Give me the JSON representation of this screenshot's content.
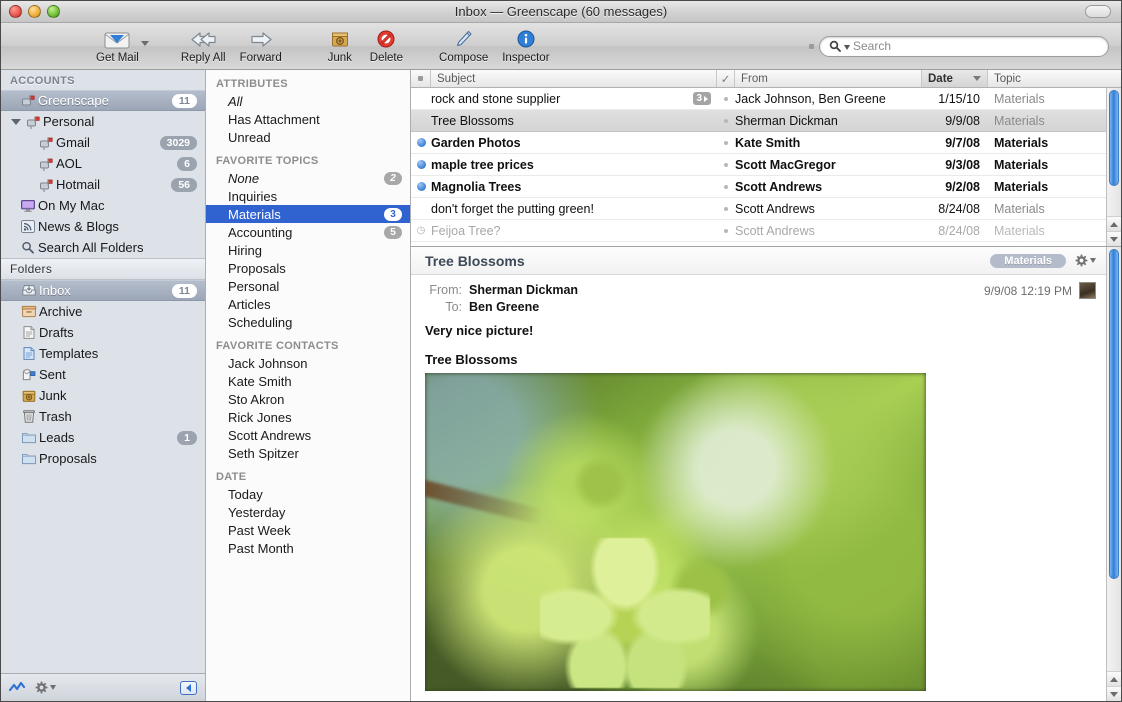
{
  "window": {
    "title": "Inbox — Greenscape (60 messages)",
    "traffic_lights": [
      "close",
      "minimize",
      "zoom"
    ],
    "toolbar_toggle": "toolbar-toggle-pill"
  },
  "toolbar": {
    "items": [
      {
        "label": "Get Mail",
        "icon": "envelope-icon",
        "has_menu": true
      },
      {
        "label": "Reply All",
        "icon": "reply-all-arrow-icon",
        "has_menu": false
      },
      {
        "label": "Forward",
        "icon": "forward-arrow-icon",
        "has_menu": false
      },
      {
        "label": "Junk",
        "icon": "junk-bin-icon",
        "has_menu": false
      },
      {
        "label": "Delete",
        "icon": "delete-prohibit-icon",
        "has_menu": false
      },
      {
        "label": "Compose",
        "icon": "pen-compose-icon",
        "has_menu": false
      },
      {
        "label": "Inspector",
        "icon": "info-circle-icon",
        "has_menu": false
      }
    ],
    "search": {
      "placeholder": "Search",
      "icon": "magnifier-icon"
    }
  },
  "sidebar": {
    "accounts_header": "ACCOUNTS",
    "accounts": [
      {
        "label": "Greenscape",
        "icon": "mailbox-icon",
        "badge": "11",
        "selected": true,
        "indent": 1,
        "disclosure": false
      },
      {
        "label": "Personal",
        "icon": "mailbox-icon",
        "badge": "",
        "selected": false,
        "indent": 1,
        "disclosure": true
      },
      {
        "label": "Gmail",
        "icon": "mailbox-icon",
        "badge": "3029",
        "selected": false,
        "indent": 2,
        "disclosure": false
      },
      {
        "label": "AOL",
        "icon": "mailbox-icon",
        "badge": "6",
        "selected": false,
        "indent": 2,
        "disclosure": false
      },
      {
        "label": "Hotmail",
        "icon": "mailbox-icon",
        "badge": "56",
        "selected": false,
        "indent": 2,
        "disclosure": false
      },
      {
        "label": "On My Mac",
        "icon": "display-icon",
        "badge": "",
        "selected": false,
        "indent": 1,
        "disclosure": false
      },
      {
        "label": "News & Blogs",
        "icon": "rss-icon",
        "badge": "",
        "selected": false,
        "indent": 1,
        "disclosure": false
      },
      {
        "label": "Search All Folders",
        "icon": "magnifier-icon",
        "badge": "",
        "selected": false,
        "indent": 1,
        "disclosure": false
      }
    ],
    "folders_header": "Folders",
    "folders": [
      {
        "label": "Inbox",
        "icon": "inbox-tray-icon",
        "badge": "11",
        "selected": true
      },
      {
        "label": "Archive",
        "icon": "archive-box-icon",
        "badge": "",
        "selected": false
      },
      {
        "label": "Drafts",
        "icon": "draft-page-icon",
        "badge": "",
        "selected": false
      },
      {
        "label": "Templates",
        "icon": "template-page-icon",
        "badge": "",
        "selected": false
      },
      {
        "label": "Sent",
        "icon": "sent-envelope-icon",
        "badge": "",
        "selected": false
      },
      {
        "label": "Junk",
        "icon": "junk-bin-icon",
        "badge": "",
        "selected": false
      },
      {
        "label": "Trash",
        "icon": "trash-can-icon",
        "badge": "",
        "selected": false
      },
      {
        "label": "Leads",
        "icon": "folder-icon",
        "badge": "1",
        "selected": false
      },
      {
        "label": "Proposals",
        "icon": "folder-icon",
        "badge": "",
        "selected": false
      }
    ],
    "footer": {
      "activity_icon": "activity-zigzag-icon",
      "gear_icon": "gear-icon",
      "collapse_icon": "collapse-left-icon"
    }
  },
  "filters": {
    "sections": [
      {
        "header": "ATTRIBUTES",
        "items": [
          {
            "label": "All",
            "italic": true,
            "badge": "",
            "selected": false
          },
          {
            "label": "Has Attachment",
            "italic": false,
            "badge": "",
            "selected": false
          },
          {
            "label": "Unread",
            "italic": false,
            "badge": "",
            "selected": false
          }
        ]
      },
      {
        "header": "FAVORITE TOPICS",
        "items": [
          {
            "label": "None",
            "italic": true,
            "badge": "2",
            "selected": false
          },
          {
            "label": "Inquiries",
            "italic": false,
            "badge": "",
            "selected": false
          },
          {
            "label": "Materials",
            "italic": false,
            "badge": "3",
            "selected": true
          },
          {
            "label": "Accounting",
            "italic": false,
            "badge": "5",
            "selected": false
          },
          {
            "label": "Hiring",
            "italic": false,
            "badge": "",
            "selected": false
          },
          {
            "label": "Proposals",
            "italic": false,
            "badge": "",
            "selected": false
          },
          {
            "label": "Personal",
            "italic": false,
            "badge": "",
            "selected": false
          },
          {
            "label": "Articles",
            "italic": false,
            "badge": "",
            "selected": false
          },
          {
            "label": "Scheduling",
            "italic": false,
            "badge": "",
            "selected": false
          }
        ]
      },
      {
        "header": "FAVORITE CONTACTS",
        "items": [
          {
            "label": "Jack Johnson",
            "italic": false,
            "badge": "",
            "selected": false
          },
          {
            "label": "Kate Smith",
            "italic": false,
            "badge": "",
            "selected": false
          },
          {
            "label": "Sto Akron",
            "italic": false,
            "badge": "",
            "selected": false
          },
          {
            "label": "Rick Jones",
            "italic": false,
            "badge": "",
            "selected": false
          },
          {
            "label": "Scott Andrews",
            "italic": false,
            "badge": "",
            "selected": false
          },
          {
            "label": "Seth Spitzer",
            "italic": false,
            "badge": "",
            "selected": false
          }
        ]
      },
      {
        "header": "DATE",
        "items": [
          {
            "label": "Today",
            "italic": false,
            "badge": "",
            "selected": false
          },
          {
            "label": "Yesterday",
            "italic": false,
            "badge": "",
            "selected": false
          },
          {
            "label": "Past Week",
            "italic": false,
            "badge": "",
            "selected": false
          },
          {
            "label": "Past Month",
            "italic": false,
            "badge": "",
            "selected": false
          }
        ]
      }
    ]
  },
  "message_list": {
    "columns": [
      {
        "label": "",
        "key": "flag",
        "active": false
      },
      {
        "label": "Subject",
        "key": "subject",
        "active": false
      },
      {
        "label": "✓",
        "key": "check",
        "active": false
      },
      {
        "label": "From",
        "key": "from",
        "active": false
      },
      {
        "label": "Date",
        "key": "date",
        "active": true,
        "sort": "descending"
      },
      {
        "label": "Topic",
        "key": "topic",
        "active": false
      }
    ],
    "rows": [
      {
        "subject": "rock and stone supplier",
        "from": "Jack Johnson, Ben Greene",
        "date": "1/15/10",
        "topic": "Materials",
        "unread": false,
        "selected": false,
        "muted": false,
        "thread_count": "3"
      },
      {
        "subject": "Tree Blossoms",
        "from": "Sherman Dickman",
        "date": "9/9/08",
        "topic": "Materials",
        "unread": false,
        "selected": true,
        "muted": false,
        "thread_count": ""
      },
      {
        "subject": "Garden Photos",
        "from": "Kate Smith",
        "date": "9/7/08",
        "topic": "Materials",
        "unread": true,
        "selected": false,
        "muted": false,
        "thread_count": ""
      },
      {
        "subject": "maple tree prices",
        "from": "Scott MacGregor",
        "date": "9/3/08",
        "topic": "Materials",
        "unread": true,
        "selected": false,
        "muted": false,
        "thread_count": ""
      },
      {
        "subject": "Magnolia Trees",
        "from": "Scott Andrews",
        "date": "9/2/08",
        "topic": "Materials",
        "unread": true,
        "selected": false,
        "muted": false,
        "thread_count": ""
      },
      {
        "subject": "don't forget the putting green!",
        "from": "Scott Andrews",
        "date": "8/24/08",
        "topic": "Materials",
        "unread": false,
        "selected": false,
        "muted": false,
        "thread_count": ""
      },
      {
        "subject": "Feijoa Tree?",
        "from": "Scott Andrews",
        "date": "8/24/08",
        "topic": "Materials",
        "unread": false,
        "selected": false,
        "muted": true,
        "thread_count": ""
      }
    ]
  },
  "message_view": {
    "subject": "Tree Blossoms",
    "tag": "Materials",
    "gear_icon": "gear-icon",
    "from_label": "From:",
    "from_value": "Sherman Dickman",
    "to_label": "To:",
    "to_value": "Ben Greene",
    "timestamp": "9/9/08 12:19 PM",
    "avatar": "contact-photo",
    "body_line_1": "Very nice picture!",
    "body_line_2": "Tree Blossoms",
    "attachment_image": "green-blossoms-photo"
  },
  "colors": {
    "selection_blue": "#3163d0",
    "sidebar_bg": "#dde2e9",
    "unread_dot": "#3a7fd5",
    "tag_pill": "#b4bccb"
  }
}
